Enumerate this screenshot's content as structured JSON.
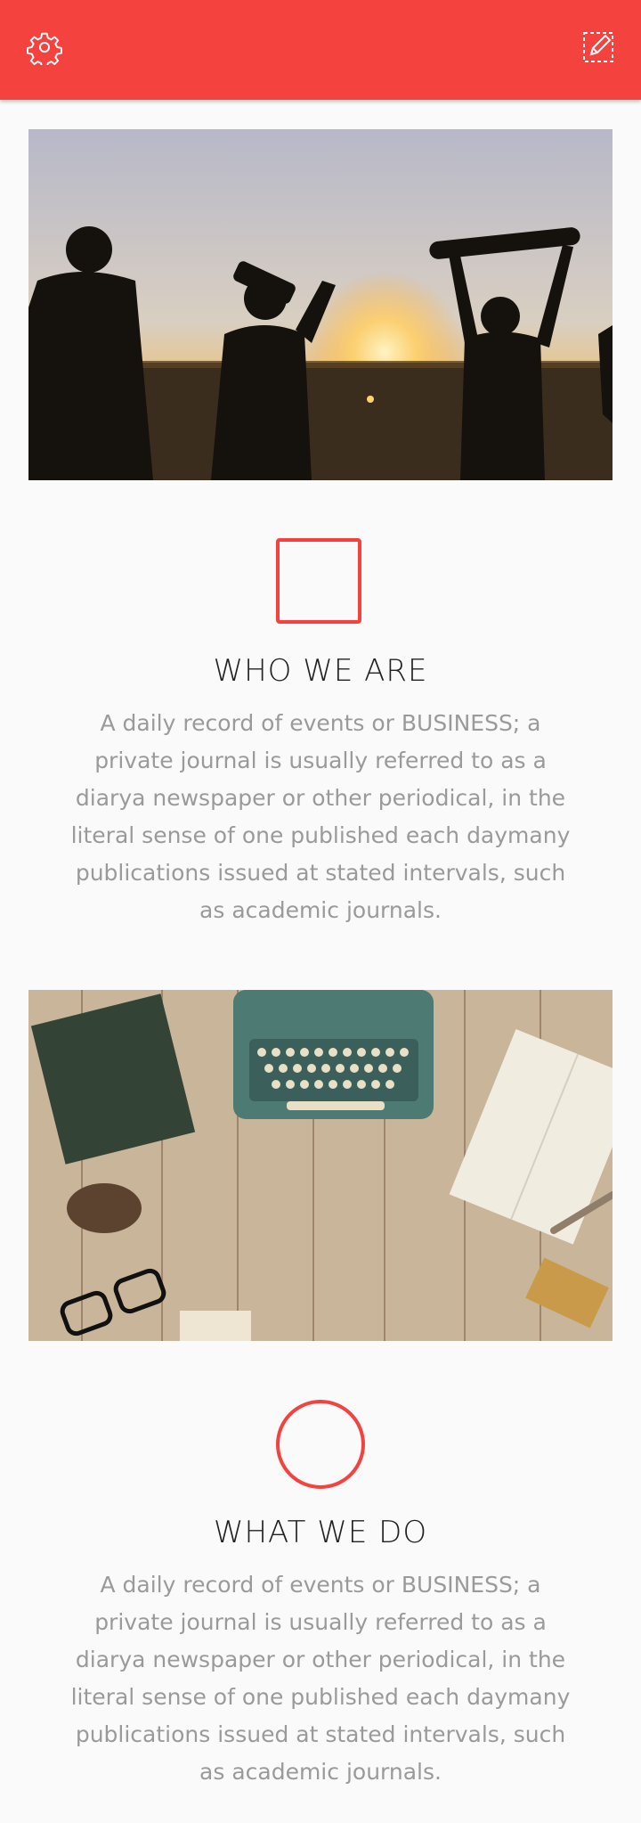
{
  "appbar": {
    "color": "#f4433f",
    "left_icon": "gear-icon",
    "right_icon": "edit-icon"
  },
  "sections": [
    {
      "image": "silhouettes-sunset-skateboards",
      "shape": "square-outline",
      "title": "WHO WE ARE",
      "text": "A daily record of events or BUSINESS; a private journal is usually referred to as a diarya newspaper or other periodical, in the literal sense of one published each daymany publications issued at stated intervals, such as academic journals."
    },
    {
      "image": "typewriter-on-wood-desk",
      "shape": "circle-outline",
      "title": "WHAT WE DO",
      "text": "A daily record of events or BUSINESS; a private journal is usually referred to as a diarya newspaper or other periodical, in the literal sense of one published each daymany publications issued at stated intervals, such as academic journals."
    }
  ]
}
